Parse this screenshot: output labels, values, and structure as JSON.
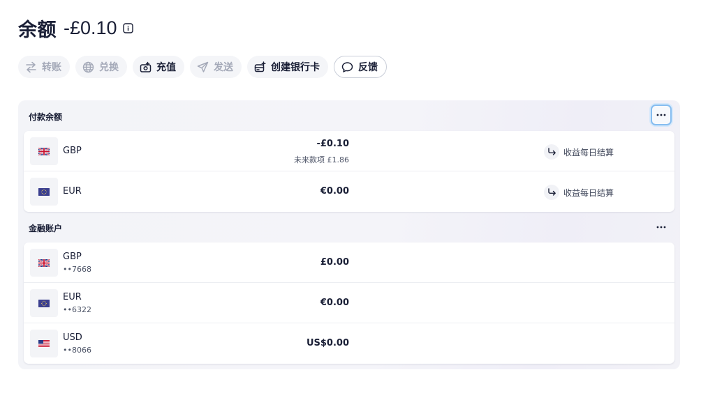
{
  "header": {
    "title": "余额",
    "amount": "-£0.10"
  },
  "actions": [
    {
      "label": "转账",
      "icon": "transfer-icon",
      "enabled": false
    },
    {
      "label": "兑换",
      "icon": "globe-icon",
      "enabled": false
    },
    {
      "label": "充值",
      "icon": "top-up-icon",
      "enabled": true
    },
    {
      "label": "发送",
      "icon": "send-icon",
      "enabled": false
    },
    {
      "label": "创建银行卡",
      "icon": "create-card-icon",
      "enabled": true
    },
    {
      "label": "反馈",
      "icon": "chat-bubble-icon",
      "enabled": true
    }
  ],
  "payment_balances": {
    "title": "付款余额",
    "rows": [
      {
        "currency": "GBP",
        "flag": "uk-flag-icon",
        "amount": "-£0.10",
        "pending": "未来款项 £1.86",
        "earn_label": "收益每日结算"
      },
      {
        "currency": "EUR",
        "flag": "eu-flag-icon",
        "amount": "€0.00",
        "earn_label": "收益每日结算"
      }
    ]
  },
  "financial_accounts": {
    "title": "金融账户",
    "rows": [
      {
        "currency": "GBP",
        "flag": "uk-flag-icon",
        "account": "••7668",
        "amount": "£0.00"
      },
      {
        "currency": "EUR",
        "flag": "eu-flag-icon",
        "account": "••6322",
        "amount": "€0.00"
      },
      {
        "currency": "USD",
        "flag": "us-flag-icon",
        "account": "••8066",
        "amount": "US$0.00"
      }
    ]
  },
  "colors": {
    "text_primary": "#1a1f36",
    "text_disabled": "#a4a9b8",
    "focus_ring": "#86bdf0",
    "eu_blue": "#3b3f8f",
    "uk_red": "#c8102e"
  }
}
